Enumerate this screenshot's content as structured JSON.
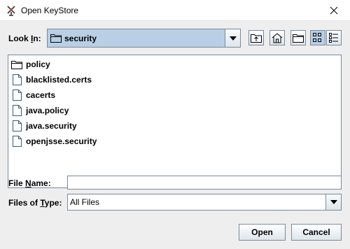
{
  "window": {
    "title": "Open KeyStore"
  },
  "look_in": {
    "label_prefix": "Look ",
    "label_mnemonic": "I",
    "label_suffix": "n:",
    "value": "security"
  },
  "toolbar": {
    "icons": [
      "up-one-level-icon",
      "home-icon",
      "new-folder-icon",
      "list-view-icon",
      "details-view-icon"
    ]
  },
  "files": [
    {
      "name": "policy",
      "type": "folder"
    },
    {
      "name": "blacklisted.certs",
      "type": "file"
    },
    {
      "name": "cacerts",
      "type": "file"
    },
    {
      "name": "java.policy",
      "type": "file"
    },
    {
      "name": "java.security",
      "type": "file"
    },
    {
      "name": "openjsse.security",
      "type": "file"
    }
  ],
  "file_name": {
    "label_prefix": "File ",
    "label_mnemonic": "N",
    "label_suffix": "ame:",
    "value": ""
  },
  "files_of_type": {
    "label_prefix": "Files of ",
    "label_mnemonic": "T",
    "label_suffix": "ype:",
    "value": "All Files"
  },
  "buttons": {
    "open": "Open",
    "cancel": "Cancel"
  }
}
